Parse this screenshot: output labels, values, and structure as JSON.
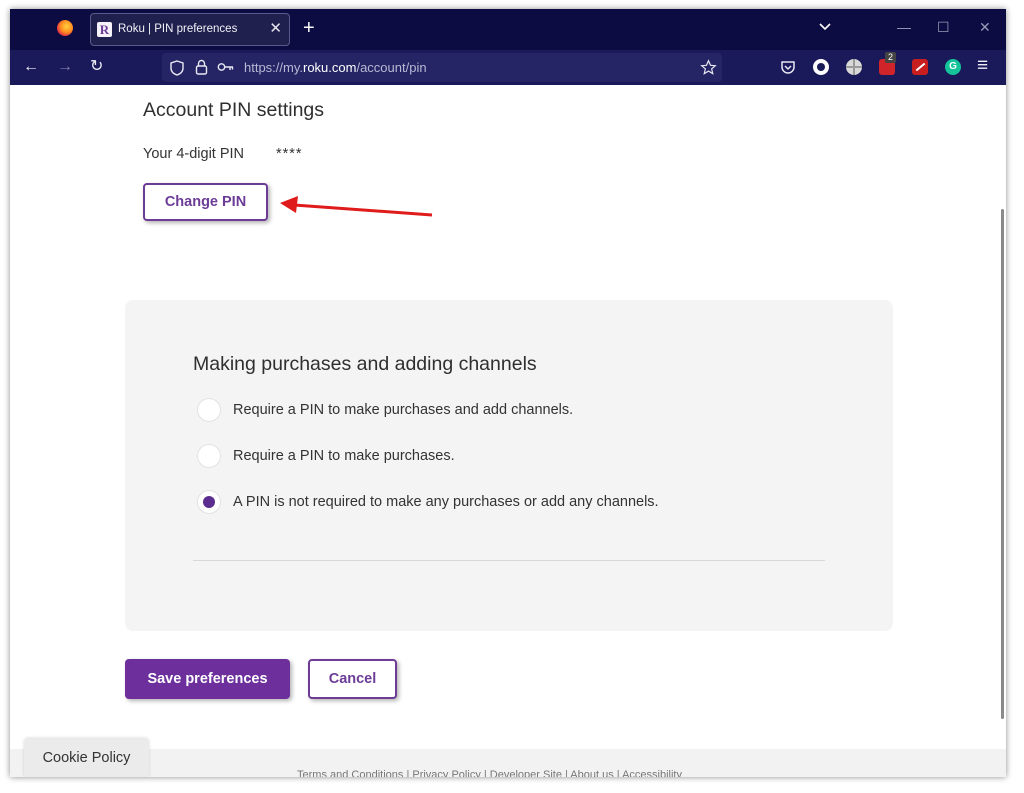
{
  "browser": {
    "tab": {
      "favicon_letter": "R",
      "title": "Roku | PIN preferences",
      "close_glyph": "✕"
    },
    "new_tab_glyph": "+",
    "window_controls": {
      "minimize": "—",
      "maximize": "☐",
      "close": "✕"
    },
    "nav": {
      "back": "←",
      "forward": "→",
      "reload": "↻",
      "menu": "≡"
    },
    "url": {
      "prefix": "https://my.",
      "host": "roku.com",
      "path": "/account/pin"
    },
    "extensions": [
      {
        "name": "pocket-icon",
        "badge": ""
      },
      {
        "name": "extension-o-icon",
        "badge": ""
      },
      {
        "name": "globe-icon",
        "badge": ""
      },
      {
        "name": "ublock-icon",
        "badge": "2"
      },
      {
        "name": "extension-red-icon",
        "badge": ""
      },
      {
        "name": "grammarly-icon",
        "badge": "G"
      }
    ],
    "colors": {
      "tabstrip": "#0c0c42",
      "navbar": "#1a1a5a",
      "accent": "#6c3c97"
    }
  },
  "account_pin": {
    "heading": "Account PIN settings",
    "pin_label": "Your 4-digit PIN",
    "pin_value": "****",
    "change_button": "Change PIN"
  },
  "purchases": {
    "heading": "Making purchases and adding channels",
    "options": [
      {
        "label": "Require a PIN to make purchases and add channels.",
        "selected": false
      },
      {
        "label": "Require a PIN to make purchases.",
        "selected": false
      },
      {
        "label": "A PIN is not required to make any purchases or add any channels.",
        "selected": true
      }
    ]
  },
  "actions": {
    "save": "Save preferences",
    "cancel": "Cancel"
  },
  "footer": {
    "links": "Terms and Conditions | Privacy Policy | Developer Site | About us | Accessibility",
    "cookie_policy": "Cookie Policy"
  }
}
